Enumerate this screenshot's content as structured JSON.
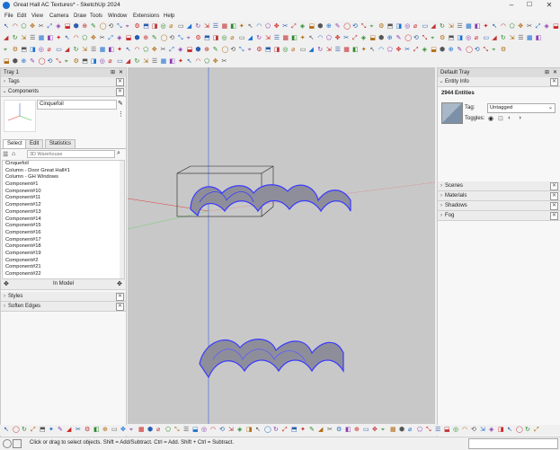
{
  "window": {
    "title": "Great Hall AC Textures* - SketchUp 2024",
    "controls": [
      "–",
      "☐",
      "✕"
    ]
  },
  "menubar": [
    "File",
    "Edit",
    "View",
    "Camera",
    "Draw",
    "Tools",
    "Window",
    "Extensions",
    "Help"
  ],
  "left_tray": {
    "title": "Tray 1",
    "sections": {
      "tags": "Tags",
      "components": "Components",
      "styles": "Styles",
      "soften": "Soften Edges"
    },
    "component_name": "Cinquefoil",
    "tabs": [
      "Select",
      "Edit",
      "Statistics"
    ],
    "search_placeholder": "3D Warehouse",
    "items": [
      "Cinquefoil",
      "Column - Door Great Hall#1",
      "Column - GH Windows",
      "Component#1",
      "Component#10",
      "Component#11",
      "Component#12",
      "Component#13",
      "Component#14",
      "Component#15",
      "Component#16",
      "Component#17",
      "Component#18",
      "Component#19",
      "Component#2",
      "Component#21",
      "Component#22"
    ],
    "in_model": "In Model"
  },
  "right_tray": {
    "title": "Default Tray",
    "entity_info": "Entity Info",
    "entity_count": "2944 Entities",
    "tag_label": "Tag:",
    "tag_value": "Untagged",
    "toggles_label": "Toggles:",
    "sections": [
      "Scenes",
      "Materials",
      "Shadows",
      "Fog"
    ]
  },
  "status": {
    "message": "Click or drag to select objects. Shift = Add/Subtract. Ctrl = Add. Shift + Ctrl = Subtract."
  },
  "colors": {
    "viewport_bg": "#c8c8c8",
    "selection": "#3a3aff",
    "axis_red": "#e04040",
    "axis_green": "#40c040",
    "axis_blue": "#4060e0"
  }
}
